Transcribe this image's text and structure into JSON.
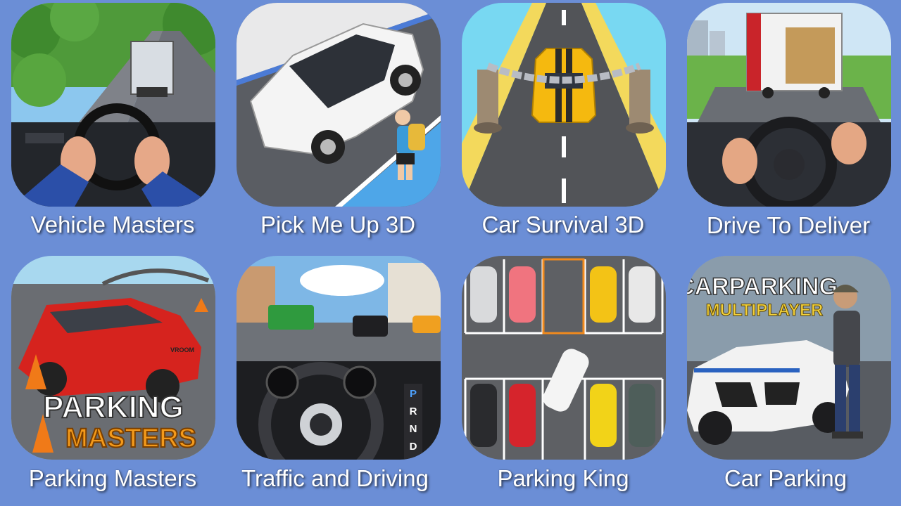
{
  "background_color": "#6b8ed6",
  "games": [
    {
      "title": "Vehicle Masters",
      "icon": "vehicle-masters-icon"
    },
    {
      "title": "Pick Me Up 3D",
      "icon": "pick-me-up-3d-icon"
    },
    {
      "title": "Car Survival 3D",
      "icon": "car-survival-3d-icon"
    },
    {
      "title": "Drive To Deliver",
      "icon": "drive-to-deliver-icon"
    },
    {
      "title": "Parking Masters",
      "icon": "parking-masters-icon",
      "icon_text": [
        "PARKING",
        "MASTERS",
        "VROOM"
      ]
    },
    {
      "title": "Traffic and Driving",
      "icon": "traffic-and-driving-icon",
      "icon_text": [
        "P",
        "R",
        "N",
        "D"
      ]
    },
    {
      "title": "Parking King",
      "icon": "parking-king-icon"
    },
    {
      "title": "Car Parking",
      "icon": "car-parking-icon",
      "icon_text": [
        "CARPARKING",
        "MULTIPLAYER"
      ]
    }
  ]
}
